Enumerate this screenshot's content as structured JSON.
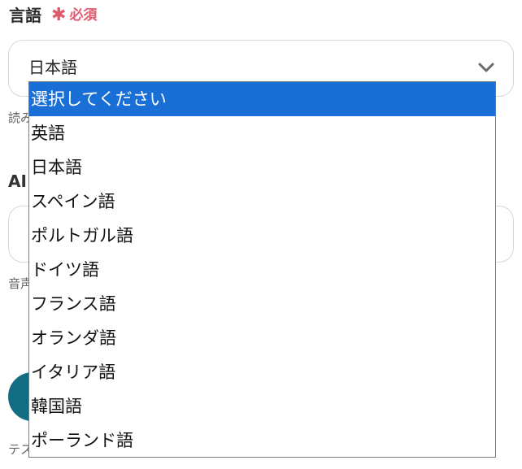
{
  "field": {
    "label": "言語",
    "required_mark": "✱",
    "required_text": "必須",
    "selected_value": "日本語"
  },
  "dropdown": {
    "options": [
      {
        "label": "選択してください",
        "selected": true
      },
      {
        "label": "英語"
      },
      {
        "label": "日本語"
      },
      {
        "label": "スペイン語"
      },
      {
        "label": "ポルトガル語"
      },
      {
        "label": "ドイツ語"
      },
      {
        "label": "フランス語"
      },
      {
        "label": "オランダ語"
      },
      {
        "label": "イタリア語"
      },
      {
        "label": "韓国語"
      },
      {
        "label": "ポーランド語"
      }
    ]
  },
  "background": {
    "help_text_1": "読み",
    "section_label_2": "AI",
    "help_text_2": "音声",
    "help_text_3": "テス"
  },
  "colors": {
    "required": "#e05a6e",
    "highlight": "#1a6fd6",
    "button": "#136d82"
  },
  "icons": {
    "chevron": "chevron-down-icon"
  }
}
